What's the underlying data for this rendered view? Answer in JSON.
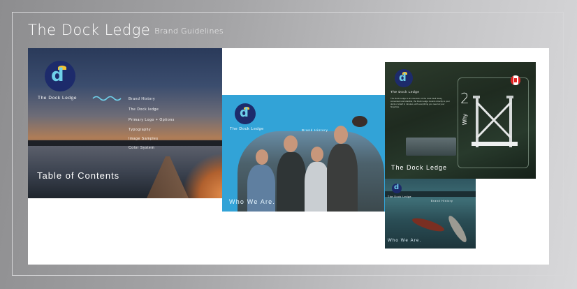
{
  "header": {
    "title": "The Dock Ledge",
    "subtitle": "Brand Guidelines"
  },
  "toc_card": {
    "brand": "The Dock Ledge",
    "items": [
      "Brand History",
      "The Dock ledge",
      "Primary Logo + Options",
      "Typography",
      "Image Samples",
      "Color System"
    ],
    "heading": "Table of Contents"
  },
  "history_card": {
    "brand": "The Dock Ledge",
    "section": "Brand History",
    "caption": "Who We Are."
  },
  "why_card": {
    "brand": "The Dock Ledge",
    "number": "2",
    "vertical": "Why",
    "caption": "The Dock Ledge",
    "body": "The Dock Ledge is an extension of the dock itself. Easy, convenient and durable, the Dock Ledge mounts directly to your dock or wharf in minutes, with everything you need at your fingertips."
  },
  "who_card": {
    "brand": "The Dock Ledge",
    "section": "Brand History",
    "caption": "Who We Are."
  },
  "colors": {
    "logo_navy": "#1d2b6b",
    "logo_cyan": "#6fd0ea",
    "logo_sun": "#f4c330",
    "history_blue": "#32a3d7",
    "flag_red": "#e02020"
  }
}
